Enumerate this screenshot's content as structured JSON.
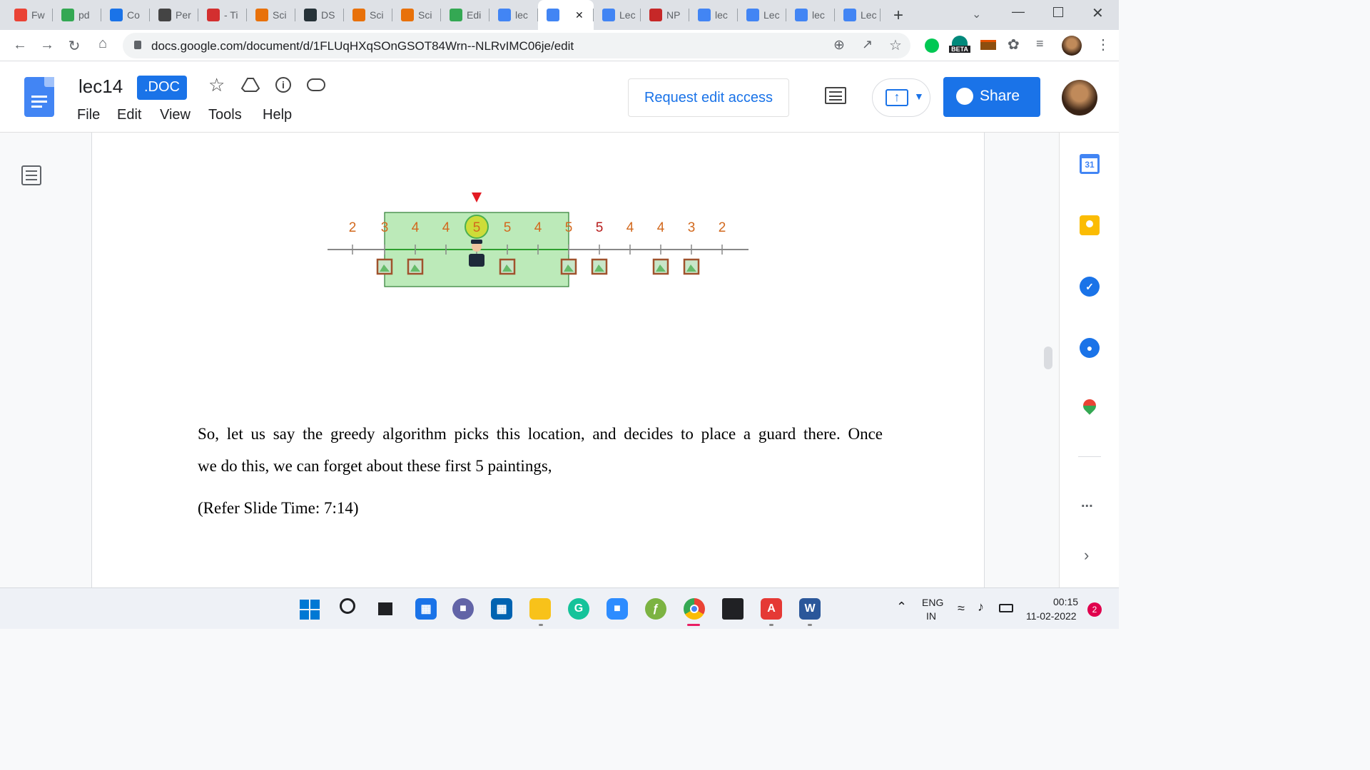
{
  "browser": {
    "tabs": [
      {
        "label": "Fw",
        "icon": "gmail-icon",
        "color": "#ea4335"
      },
      {
        "label": "pd",
        "icon": "google-drive-icon",
        "color": "#34a853"
      },
      {
        "label": "Co",
        "icon": "link-icon",
        "color": "#1a73e8"
      },
      {
        "label": "Per",
        "icon": "perplexity-icon",
        "color": "#444"
      },
      {
        "label": "- Ti",
        "icon": "adobe-icon",
        "color": "#d32f2f"
      },
      {
        "label": "Sci",
        "icon": "scihub-icon",
        "color": "#e8710a"
      },
      {
        "label": "DS",
        "icon": "forward-icon",
        "color": "#263238"
      },
      {
        "label": "Sci",
        "icon": "scihub-icon",
        "color": "#e8710a"
      },
      {
        "label": "Sci",
        "icon": "scihub-icon",
        "color": "#e8710a"
      },
      {
        "label": "Edi",
        "icon": "google-drive-icon",
        "color": "#34a853"
      },
      {
        "label": "lec",
        "icon": "google-docs-icon",
        "color": "#4285f4"
      },
      {
        "label": "",
        "icon": "google-docs-icon",
        "color": "#4285f4",
        "active": true
      },
      {
        "label": "Lec",
        "icon": "google-docs-icon",
        "color": "#4285f4"
      },
      {
        "label": "NP",
        "icon": "nptel-icon",
        "color": "#c62828"
      },
      {
        "label": "lec",
        "icon": "google-docs-icon",
        "color": "#4285f4"
      },
      {
        "label": "Lec",
        "icon": "google-docs-icon",
        "color": "#4285f4"
      },
      {
        "label": "lec",
        "icon": "google-docs-icon",
        "color": "#4285f4"
      },
      {
        "label": "Lec",
        "icon": "google-docs-icon",
        "color": "#4285f4"
      }
    ],
    "url": "docs.google.com/document/d/1FLUqHXqSOnGSOT84Wrn--NLRvIMC06je/edit",
    "beta_label": "BETA"
  },
  "doc": {
    "title": "lec14",
    "badge": ".DOC",
    "menu": [
      "File",
      "Edit",
      "View",
      "Tools",
      "Help"
    ],
    "request_edit_label": "Request edit access",
    "share_label": "Share"
  },
  "figure": {
    "tick_numbers_orange": [
      "2",
      "3",
      "4",
      "4",
      "5",
      "5",
      "4",
      "5"
    ],
    "tick_numbers_right": [
      "5",
      "4",
      "4",
      "3",
      "2"
    ],
    "highlight_color": "#a6e3a1"
  },
  "body": {
    "paragraph_line1": "So, let us say the greedy algorithm picks this location, and decides to place a guard there. Once",
    "paragraph_line2": "we do this, we can forget about these first 5 paintings,",
    "refer": "(Refer Slide Time: 7:14)"
  },
  "right_panel": {
    "calendar_day": "31",
    "more": "..."
  },
  "taskbar": {
    "lang_top": "ENG",
    "lang_bottom": "IN",
    "time": "00:15",
    "date": "11-02-2022",
    "notif_count": "2"
  }
}
